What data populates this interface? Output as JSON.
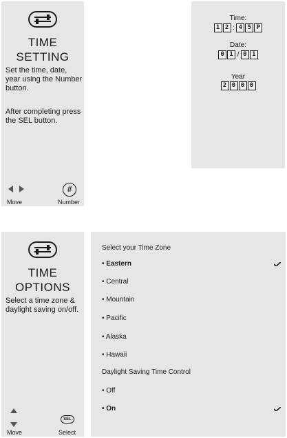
{
  "time_setting": {
    "title_line1": "TIME",
    "title_line2": "SETTING",
    "description": "Set the time, date, year using the Number button.",
    "description_2": "After completing press the SEL button.",
    "controls": {
      "move_label": "Move",
      "number_label": "Number",
      "number_button_glyph": "#"
    }
  },
  "display": {
    "time_label": "Time:",
    "time_digits": [
      "1",
      "2",
      "4",
      "5",
      "P"
    ],
    "time_separator": ":",
    "date_label": "Date:",
    "date_digits": [
      "0",
      "1",
      "0",
      "1"
    ],
    "date_separator": "/",
    "year_label": "Year",
    "year_digits": [
      "2",
      "0",
      "0",
      "0"
    ]
  },
  "time_options": {
    "title_line1": "TIME",
    "title_line2": "OPTIONS",
    "description": "Select a time zone & daylight saving on/off.",
    "controls": {
      "move_label": "Move",
      "select_label": "Select",
      "select_button_glyph": "SEL"
    }
  },
  "time_zone_menu": {
    "heading": "Select your Time Zone",
    "zones": [
      {
        "label": "• Eastern",
        "selected": true
      },
      {
        "label": "• Central",
        "selected": false
      },
      {
        "label": "• Mountain",
        "selected": false
      },
      {
        "label": "• Pacific",
        "selected": false
      },
      {
        "label": "• Alaska",
        "selected": false
      },
      {
        "label": "• Hawaii",
        "selected": false
      }
    ],
    "dst_heading": "Daylight Saving Time Control",
    "dst_options": [
      {
        "label": "• Off",
        "selected": false
      },
      {
        "label": "• On",
        "selected": true
      }
    ]
  },
  "icons": {
    "tool": "wrench-screwdriver-icon",
    "left": "left-arrow-icon",
    "right": "right-arrow-icon",
    "up": "up-arrow-icon",
    "down": "down-arrow-icon",
    "check": "checkmark-icon"
  }
}
